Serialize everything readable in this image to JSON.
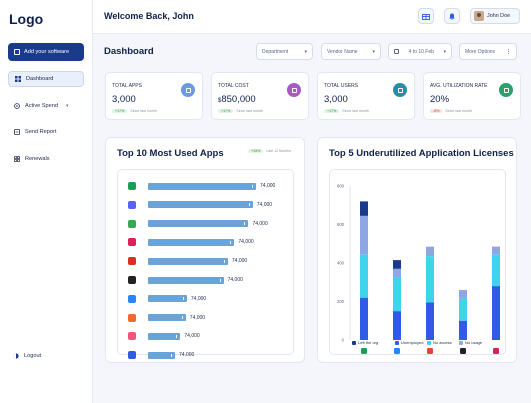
{
  "sidebar": {
    "logo": "Logo",
    "add_label": "Add your software",
    "items": [
      {
        "label": "Dashboard"
      },
      {
        "label": "Active Spend"
      },
      {
        "label": "Send Report"
      },
      {
        "label": "Renewals"
      }
    ],
    "logout": "Logout"
  },
  "header": {
    "welcome": "Welcome Back, John",
    "user_name": "John Doe"
  },
  "dashboard": {
    "title": "Dashboard",
    "filters": {
      "department": "Department",
      "vendor": "Vendor Name",
      "date": "4 to 10 Feb",
      "more": "More Options"
    }
  },
  "kpis": [
    {
      "label": "TOTAL APPS",
      "currency": "",
      "value": "3,000",
      "delta": "+17%",
      "delta_dir": "up",
      "note": "Since last month",
      "icon": "grid-icon",
      "color": "#6d9be3"
    },
    {
      "label": "TOTAL COST",
      "currency": "$",
      "value": "850,000",
      "delta": "+17%",
      "delta_dir": "up",
      "note": "Since last month",
      "icon": "money-icon",
      "color": "#a858c8"
    },
    {
      "label": "TOTAL USERS",
      "currency": "",
      "value": "3,000",
      "delta": "+17%",
      "delta_dir": "up",
      "note": "Since last month",
      "icon": "users-icon",
      "color": "#2a8ca8"
    },
    {
      "label": "AVG. UTILIZATION RATE",
      "currency": "",
      "value": "20%",
      "delta": "-8%",
      "delta_dir": "down",
      "note": "Since last month",
      "icon": "chart-icon",
      "color": "#2aa06a"
    }
  ],
  "top_apps": {
    "title": "Top 10 Most Used Apps",
    "badge": "+15%",
    "badge_note": "Last 12 Months"
  },
  "underutilized": {
    "title": "Top 5 Underutilized Application Licenses"
  },
  "chart_data": [
    {
      "type": "bar",
      "orientation": "horizontal",
      "categories": [
        "google-sheets",
        "discord",
        "google-drive",
        "slack",
        "gmail",
        "mailchimp",
        "confluence",
        "unknown-orange",
        "asana",
        "jira"
      ],
      "values": [
        74000,
        74000,
        74000,
        74000,
        74000,
        74000,
        74000,
        74000,
        74000,
        74000
      ],
      "value_labels": [
        "74,000",
        "74,000",
        "74,000",
        "74,000",
        "74,000",
        "74,000",
        "74,000",
        "74,000",
        "74,000",
        "74,000"
      ],
      "bar_lengths_relative": [
        1.0,
        0.97,
        0.93,
        0.8,
        0.74,
        0.7,
        0.36,
        0.35,
        0.3,
        0.25
      ],
      "colors": {
        "bar": "#6aa3d8"
      }
    },
    {
      "type": "bar",
      "stacked": true,
      "categories": [
        "google-sheets",
        "jira",
        "google",
        "notion",
        "slack"
      ],
      "y_ticks": [
        "0",
        "200",
        "400",
        "600",
        "800"
      ],
      "ylim": [
        0,
        800
      ],
      "grid": false,
      "legend_position": "bottom",
      "series": [
        {
          "name": "Left the org",
          "color": "#1a3a8c",
          "values": [
            0,
            0,
            0,
            0,
            0
          ]
        },
        {
          "name": "Unemployed",
          "color": "#2f5be6",
          "values": [
            220,
            150,
            195,
            100,
            280
          ]
        },
        {
          "name": "No access",
          "color": "#3fd4ec",
          "values": [
            225,
            175,
            240,
            115,
            165
          ]
        },
        {
          "name": "No usage",
          "color": "#8ea6e3",
          "values": [
            200,
            45,
            50,
            45,
            40
          ]
        },
        {
          "name": "Left the org (top)",
          "color": "#1a3a8c",
          "values": [
            75,
            45,
            0,
            0,
            0
          ]
        }
      ],
      "totals": [
        710,
        410,
        485,
        260,
        485
      ]
    }
  ],
  "colors": {
    "primary": "#1a3a8c",
    "accent_bar": "#6aa3d8",
    "background": "#f4f6fb"
  }
}
